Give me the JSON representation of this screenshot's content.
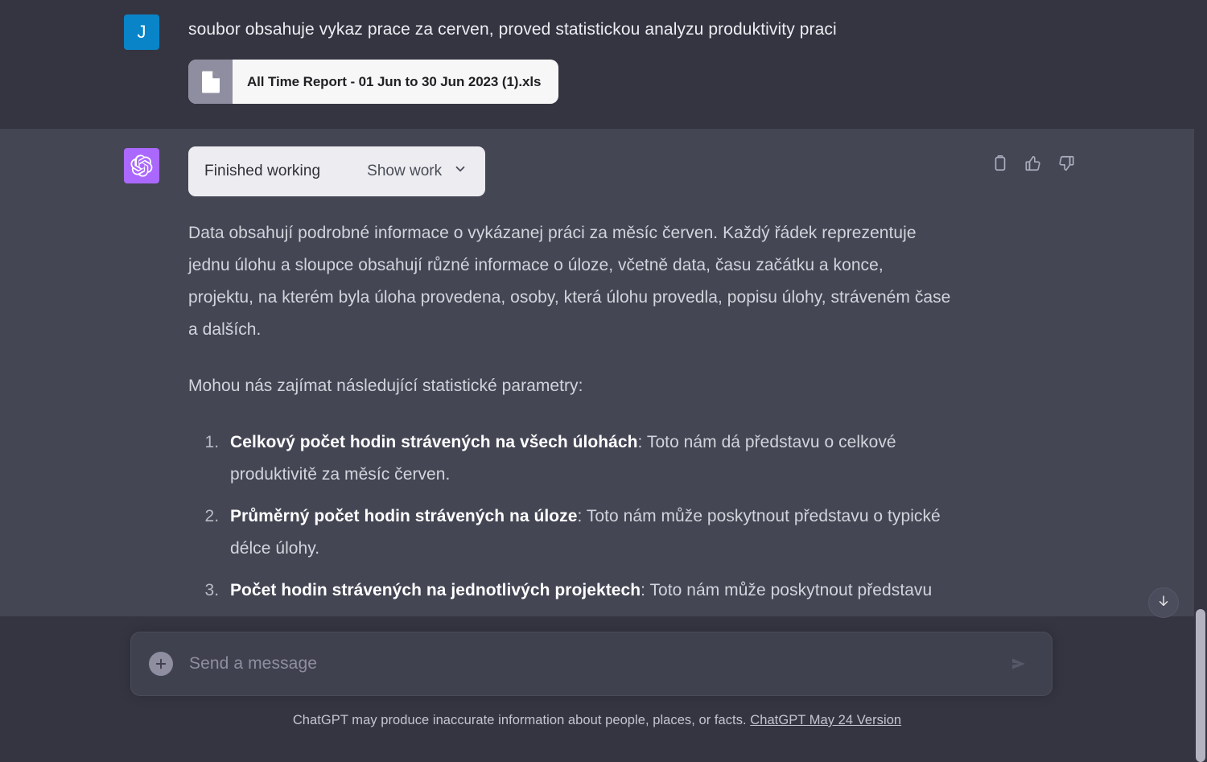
{
  "colors": {
    "user_bg": "#343541",
    "assistant_bg": "#444654",
    "user_avatar": "#0a84c8",
    "bot_avatar": "#ab68ff",
    "accent_chip": "#ececf1",
    "composer_bg": "#40414f"
  },
  "user_message": {
    "avatar_initial": "J",
    "text": "soubor obsahuje vykaz prace za cerven, proved statistickou analyzu produktivity praci",
    "attachment": {
      "filename": "All Time Report - 01 Jun to 30 Jun 2023 (1).xls",
      "icon": "document-icon"
    }
  },
  "assistant_message": {
    "tool_bar": {
      "status_label": "Finished working",
      "toggle_label": "Show work",
      "chevron": "chevron-down-icon"
    },
    "paragraphs": [
      "Data obsahují podrobné informace o vykázanej práci za měsíc červen. Každý řádek reprezentuje jednu úlohu a sloupce obsahují různé informace o úloze, včetně data, času začátku a konce, projektu, na kterém byla úloha provedena, osoby, která úlohu provedla, popisu úlohy, stráveném čase a dalších.",
      "Mohou nás zajímat následující statistické parametry:"
    ],
    "list": [
      {
        "bold": "Celkový počet hodin strávených na všech úlohách",
        "rest": ": Toto nám dá představu o celkové produktivitě za měsíc červen."
      },
      {
        "bold": "Průměrný počet hodin strávených na úloze",
        "rest": ": Toto nám může poskytnout představu o typické délce úlohy."
      },
      {
        "bold": "Počet hodin strávených na jednotlivých projektech",
        "rest": ": Toto nám může poskytnout představu"
      }
    ],
    "actions": [
      {
        "name": "copy-icon",
        "label": "Copy"
      },
      {
        "name": "thumbs-up-icon",
        "label": "Good response"
      },
      {
        "name": "thumbs-down-icon",
        "label": "Bad response"
      }
    ]
  },
  "composer": {
    "placeholder": "Send a message",
    "value": "",
    "plus_icon": "plus-icon",
    "send_icon": "send-icon"
  },
  "footer": {
    "disclaimer": "ChatGPT may produce inaccurate information about people, places, or facts.",
    "version_link": "ChatGPT May 24 Version"
  },
  "scroll_button": {
    "icon": "arrow-down-icon"
  }
}
